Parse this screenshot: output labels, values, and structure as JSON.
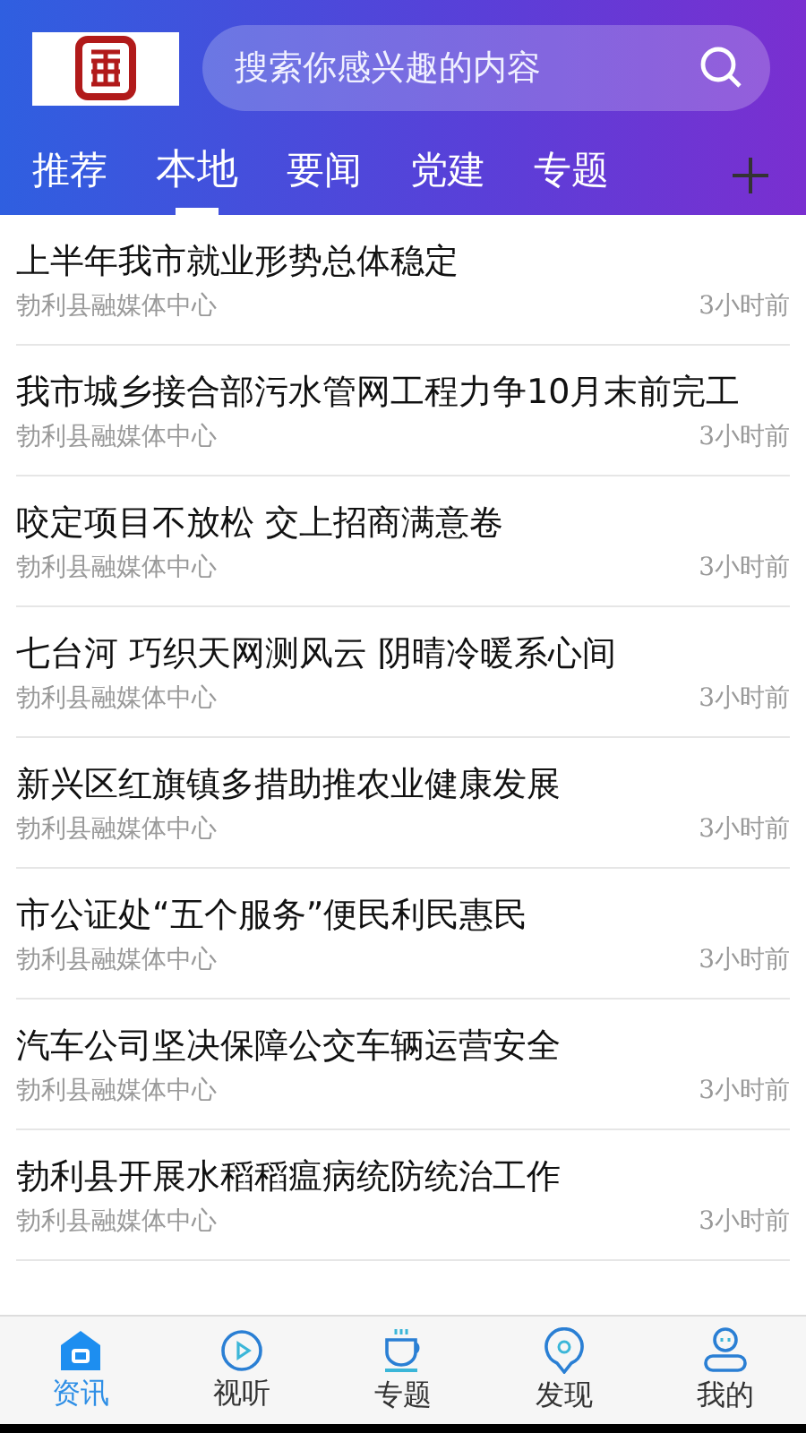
{
  "search": {
    "placeholder": "搜索你感兴趣的内容"
  },
  "tabs": [
    {
      "label": "推荐",
      "selected": false
    },
    {
      "label": "本地",
      "selected": true
    },
    {
      "label": "要闻",
      "selected": false
    },
    {
      "label": "党建",
      "selected": false
    },
    {
      "label": "专题",
      "selected": false
    }
  ],
  "news": [
    {
      "title": "上半年我市就业形势总体稳定",
      "source": "勃利县融媒体中心",
      "time": "3小时前"
    },
    {
      "title": "我市城乡接合部污水管网工程力争10月末前完工",
      "source": "勃利县融媒体中心",
      "time": "3小时前"
    },
    {
      "title": "咬定项目不放松 交上招商满意卷",
      "source": "勃利县融媒体中心",
      "time": "3小时前"
    },
    {
      "title": "七台河 巧织天网测风云 阴晴冷暖系心间",
      "source": "勃利县融媒体中心",
      "time": "3小时前"
    },
    {
      "title": "新兴区红旗镇多措助推农业健康发展",
      "source": "勃利县融媒体中心",
      "time": "3小时前"
    },
    {
      "title": "市公证处“五个服务”便民利民惠民",
      "source": "勃利县融媒体中心",
      "time": "3小时前"
    },
    {
      "title": "汽车公司坚决保障公交车辆运营安全",
      "source": "勃利县融媒体中心",
      "time": "3小时前"
    },
    {
      "title": "勃利县开展水稻稻瘟病统防统治工作",
      "source": "勃利县融媒体中心",
      "time": "3小时前"
    }
  ],
  "bottom_nav": [
    {
      "label": "资讯",
      "kind": "home",
      "selected": true
    },
    {
      "label": "视听",
      "kind": "play",
      "selected": false
    },
    {
      "label": "专题",
      "kind": "cup",
      "selected": false
    },
    {
      "label": "发现",
      "kind": "pin",
      "selected": false
    },
    {
      "label": "我的",
      "kind": "user",
      "selected": false
    }
  ]
}
